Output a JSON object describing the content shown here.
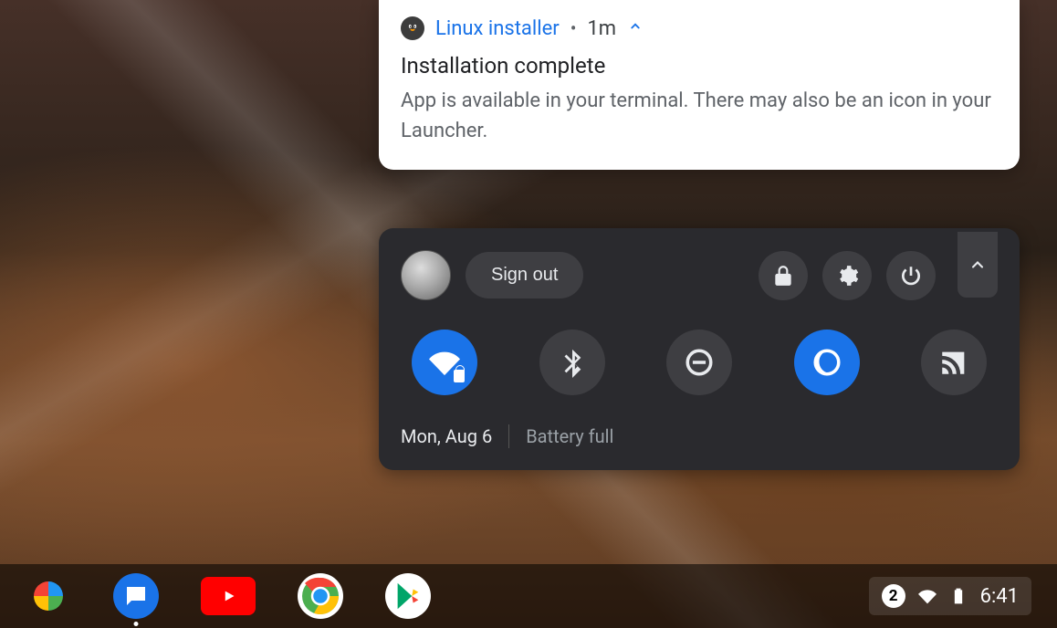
{
  "notification": {
    "app_name": "Linux installer",
    "time": "1m",
    "title": "Installation complete",
    "body": "App is available in your terminal. There may also be an icon in your Launcher."
  },
  "quick_settings": {
    "sign_out_label": "Sign out",
    "date": "Mon, Aug 6",
    "battery_status": "Battery full",
    "toggles": {
      "wifi_active": true,
      "bluetooth_active": false,
      "dnd_active": false,
      "night_light_active": true,
      "cast_active": false
    }
  },
  "shelf": {
    "apps": [
      "Photos",
      "Messages",
      "YouTube",
      "Chrome",
      "Play Store"
    ],
    "running_indicator_index": 1
  },
  "status_tray": {
    "notification_count": "2",
    "time": "6:41"
  },
  "colors": {
    "accent": "#1a73e8",
    "panel": "#2a2a2e"
  }
}
